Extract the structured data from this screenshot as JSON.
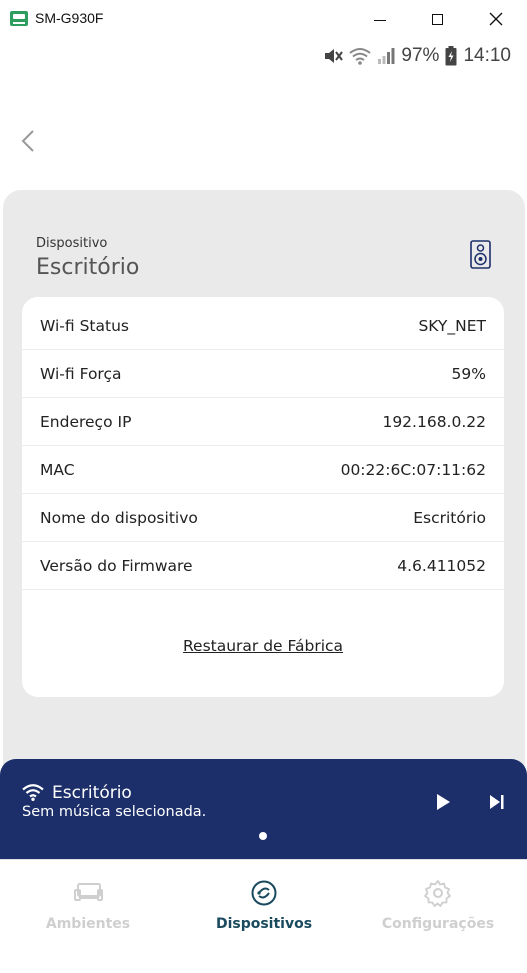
{
  "window": {
    "title": "SM-G930F"
  },
  "status_bar": {
    "battery": "97%",
    "time": "14:10",
    "icons": [
      "mute-icon",
      "wifi-icon",
      "signal-icon",
      "battery-charging-icon"
    ]
  },
  "header": {
    "back_icon": "chevron-left-icon"
  },
  "device": {
    "label": "Dispositivo",
    "name": "Escritório",
    "icon": "speaker-icon"
  },
  "info": {
    "rows": [
      {
        "label": "Wi-fi Status",
        "value": "SKY_NET"
      },
      {
        "label": "Wi-fi Força",
        "value": "59%"
      },
      {
        "label": "Endereço IP",
        "value": "192.168.0.22"
      },
      {
        "label": "MAC",
        "value": "00:22:6C:07:11:62"
      },
      {
        "label": "Nome do dispositivo",
        "value": "Escritório"
      },
      {
        "label": "Versão do Firmware",
        "value": "4.6.411052"
      }
    ],
    "reset_label": "Restaurar de Fábrica"
  },
  "player": {
    "title": "Escritório",
    "subtitle": "Sem música selecionada.",
    "accent": "#1c2f6a"
  },
  "nav": {
    "items": [
      {
        "label": "Ambientes",
        "icon": "sofa-icon",
        "active": false
      },
      {
        "label": "Dispositivos",
        "icon": "device-icon",
        "active": true
      },
      {
        "label": "Configurações",
        "icon": "gear-icon",
        "active": false
      }
    ],
    "active_color": "#1a4a5e",
    "inactive_color": "#cfcfcf"
  }
}
